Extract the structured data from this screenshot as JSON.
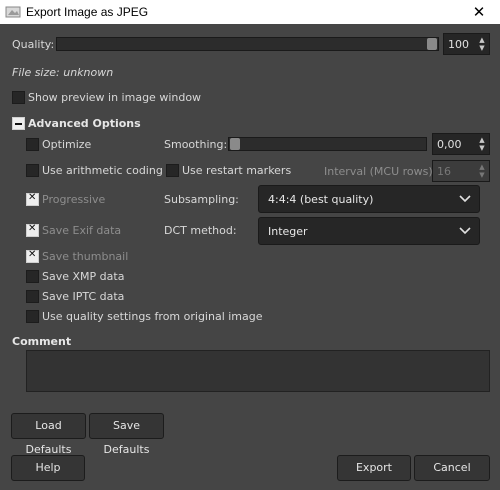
{
  "window": {
    "title": "Export Image as JPEG",
    "close_glyph": "✕"
  },
  "quality": {
    "label": "Quality:",
    "value": "100",
    "level_percent": 100
  },
  "file_size": "File size: unknown",
  "show_preview": {
    "label": "Show preview in image window",
    "checked": false
  },
  "advanced": {
    "label": "Advanced Options",
    "expanded": true
  },
  "options": {
    "optimize": {
      "label": "Optimize",
      "checked": false
    },
    "arithmetic": {
      "label": "Use arithmetic coding",
      "checked": false
    },
    "progressive": {
      "label": "Progressive",
      "checked": true
    },
    "save_exif": {
      "label": "Save Exif data",
      "checked": true
    },
    "save_thumbnail": {
      "label": "Save thumbnail",
      "checked": true
    },
    "save_xmp": {
      "label": "Save XMP data",
      "checked": false
    },
    "save_iptc": {
      "label": "Save IPTC data",
      "checked": false
    },
    "use_quality": {
      "label": "Use quality settings from original image",
      "checked": false
    },
    "restart_markers": {
      "label": "Use restart markers",
      "checked": false
    }
  },
  "smoothing": {
    "label": "Smoothing:",
    "value": "0,00",
    "level_percent": 0
  },
  "interval": {
    "label": "Interval (MCU rows):",
    "value": "16"
  },
  "subsampling": {
    "label": "Subsampling:",
    "value": "4:4:4 (best quality)"
  },
  "dct": {
    "label": "DCT method:",
    "value": "Integer"
  },
  "comment": {
    "label": "Comment",
    "value": ""
  },
  "buttons": {
    "load_defaults": "Load Defaults",
    "save_defaults": "Save Defaults",
    "help": "Help",
    "export": "Export",
    "cancel": "Cancel"
  }
}
